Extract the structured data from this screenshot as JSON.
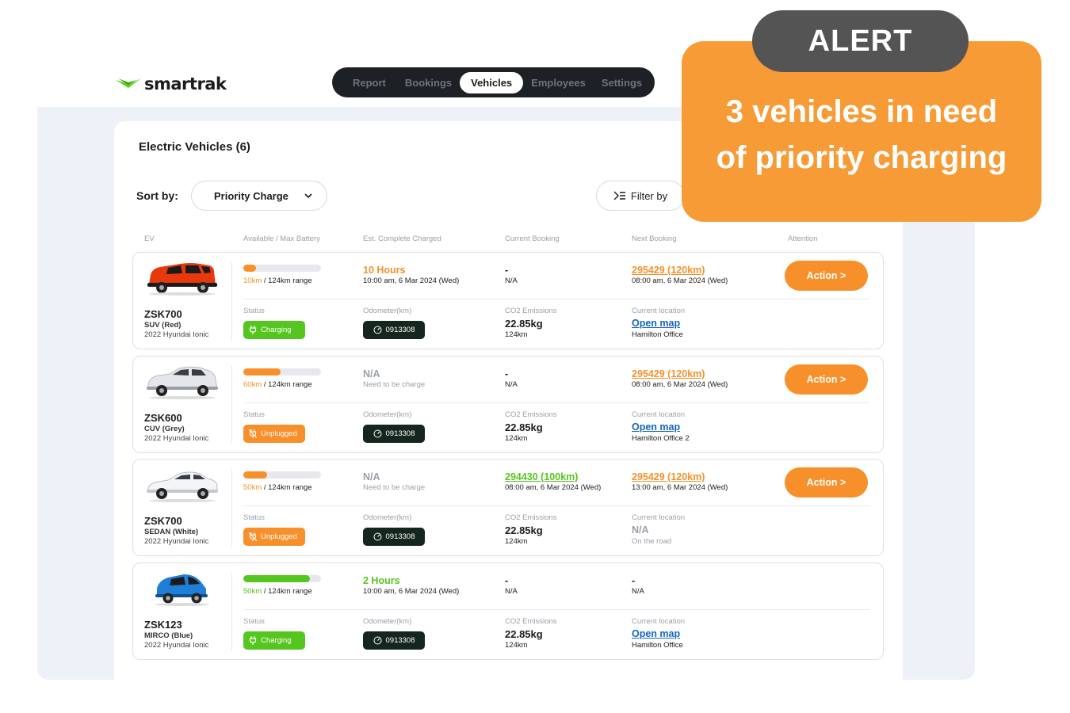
{
  "app": {
    "brand": "smartrak"
  },
  "nav": {
    "items": [
      "Report",
      "Bookings",
      "Vehicles",
      "Employees",
      "Settings"
    ],
    "active": "Vehicles"
  },
  "page": {
    "title": "Electric Vehicles (6)"
  },
  "sort": {
    "label": "Sort by:",
    "value": "Priority Charge"
  },
  "filter": {
    "label": "Filter by"
  },
  "columns": {
    "ev": "EV",
    "battery": "Available / Max Battery",
    "est": "Est. Complete Charged",
    "current": "Current Booking",
    "next": "Next Booking",
    "attention": "Attention"
  },
  "labels": {
    "status": "Status",
    "odometer": "Odometer(km)",
    "co2": "CO2 Emissions",
    "location": "Current location"
  },
  "vehicles": [
    {
      "plate": "ZSK700",
      "type": "SUV (Red)",
      "model": "2022 Hyundai Ionic",
      "battery_fraction": 0.16,
      "battery_km": "10km",
      "range": " / 124km range",
      "est_main": "10 Hours",
      "est_sub": "10:00 am, 6 Mar 2024 (Wed)",
      "current_main": "-",
      "current_sub": "N/A",
      "next_main": "295429  (120km)",
      "next_sub": "08:00 am, 6 Mar 2024 (Wed)",
      "action": "Action >",
      "status": "Charging",
      "odometer": "0913308",
      "co2": "22.85kg",
      "co2_sub": "124km",
      "location_main": "Open map",
      "location_sub": "Hamilton Office",
      "car_color": "#e8380d"
    },
    {
      "plate": "ZSK600",
      "type": "CUV (Grey)",
      "model": "2022 Hyundai Ionic",
      "battery_fraction": 0.48,
      "battery_km": "60km",
      "range": " / 124km range",
      "est_main": "N/A",
      "est_sub": "Need to be charge",
      "current_main": "-",
      "current_sub": "N/A",
      "next_main": "295429  (120km)",
      "next_sub": "08:00 am, 6 Mar 2024 (Wed)",
      "action": "Action >",
      "status": "Unplugged",
      "odometer": "0913308",
      "co2": "22.85kg",
      "co2_sub": "124km",
      "location_main": "Open map",
      "location_sub": "Hamilton Office 2",
      "car_color": "#e4e6ea"
    },
    {
      "plate": "ZSK700",
      "type": "SEDAN (White)",
      "model": "2022 Hyundai Ionic",
      "battery_fraction": 0.31,
      "battery_km": "50km",
      "range": " / 124km range",
      "est_main": "N/A",
      "est_sub": "Need to be charge",
      "current_main": "294430 (100km)",
      "current_sub": "08:00 am, 6 Mar 2024 (Wed)",
      "next_main": "295429  (120km)",
      "next_sub": "13:00 am, 6 Mar 2024 (Wed)",
      "action": "Action >",
      "status": "Unplugged",
      "odometer": "0913308",
      "co2": "22.85kg",
      "co2_sub": "124km",
      "location_main": "N/A",
      "location_sub": "On the road",
      "car_color": "#f4f5f7"
    },
    {
      "plate": "ZSK123",
      "type": "MIRCO (Blue)",
      "model": "2022 Hyundai Ionic",
      "battery_fraction": 0.86,
      "battery_km": "50km",
      "range": " / 124km range",
      "est_main": "2 Hours",
      "est_sub": "10:00 am, 6 Mar 2024 (Wed)",
      "current_main": "-",
      "current_sub": "N/A",
      "next_main": "-",
      "next_sub": "N/A",
      "action": "",
      "status": "Charging",
      "odometer": "0913308",
      "co2": "22.85kg",
      "co2_sub": "124km",
      "location_main": "Open map",
      "location_sub": "Hamilton Office",
      "car_color": "#1f7fd8"
    }
  ],
  "alert": {
    "tag": "ALERT",
    "line1": "3 vehicles in need",
    "line2": "of priority charging"
  },
  "colors": {
    "accent": "#f7902a",
    "charging": "#55c61f",
    "nav_bg": "#1d2025",
    "link": "#1565c0",
    "alert_bg": "#f79b37",
    "alert_tag_bg": "#545454"
  }
}
